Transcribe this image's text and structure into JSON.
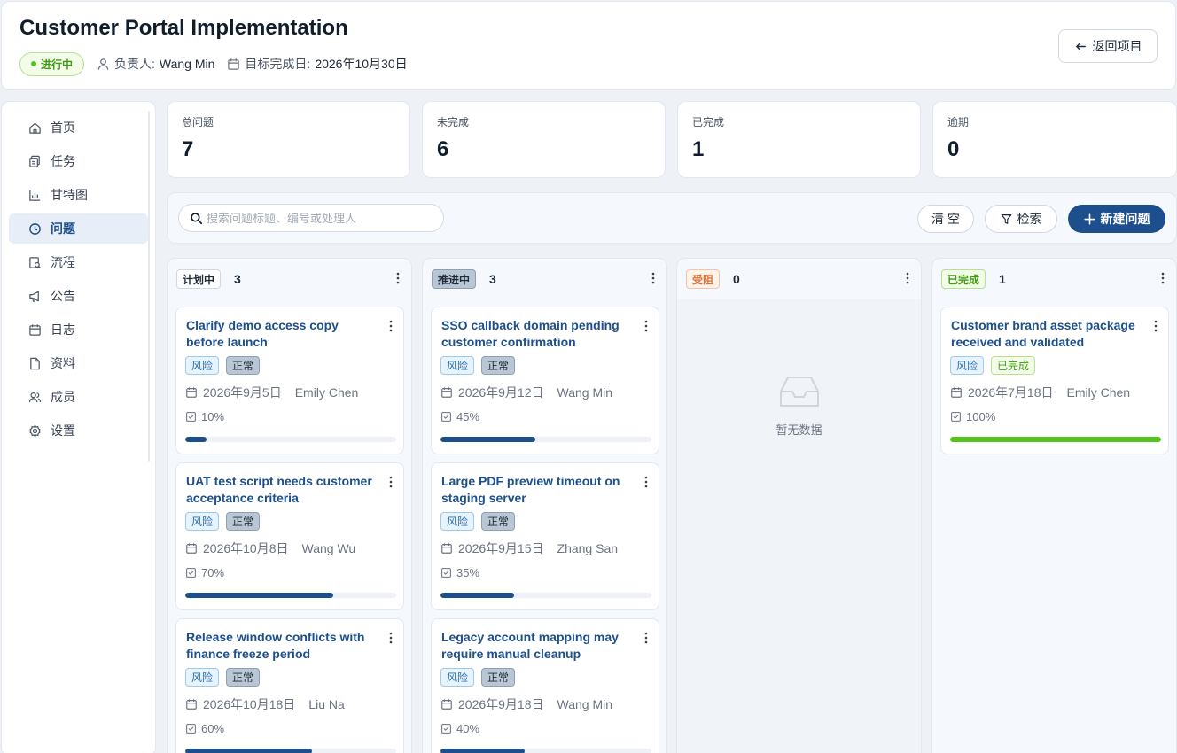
{
  "header": {
    "title": "Customer Portal Implementation",
    "status": "进行中",
    "owner_label": "负责人:",
    "owner": "Wang Min",
    "due_label": "目标完成日:",
    "due": "2026年10月30日",
    "back_label": "返回项目"
  },
  "sidebar": {
    "items": [
      {
        "label": "首页",
        "icon": "home-icon",
        "active": false
      },
      {
        "label": "任务",
        "icon": "tasks-icon",
        "active": false
      },
      {
        "label": "甘特图",
        "icon": "gantt-icon",
        "active": false
      },
      {
        "label": "问题",
        "icon": "issue-icon",
        "active": true
      },
      {
        "label": "流程",
        "icon": "workflow-icon",
        "active": false
      },
      {
        "label": "公告",
        "icon": "megaphone-icon",
        "active": false
      },
      {
        "label": "日志",
        "icon": "calendar-icon",
        "active": false
      },
      {
        "label": "资料",
        "icon": "file-icon",
        "active": false
      },
      {
        "label": "成员",
        "icon": "members-icon",
        "active": false
      },
      {
        "label": "设置",
        "icon": "gear-icon",
        "active": false
      }
    ]
  },
  "stats": [
    {
      "label": "总问题",
      "value": "7"
    },
    {
      "label": "未完成",
      "value": "6"
    },
    {
      "label": "已完成",
      "value": "1"
    },
    {
      "label": "逾期",
      "value": "0"
    }
  ],
  "toolbar": {
    "search_placeholder": "搜索问题标题、编号或处理人",
    "search_value": "",
    "clear_label": "清 空",
    "filter_label": "检索",
    "create_label": "新建问题"
  },
  "columns": [
    {
      "tag": "计划中",
      "count": "3",
      "tag_colors": {
        "bg": "#ffffff",
        "border": "#d0d7e2",
        "text": "#1f2937"
      },
      "cards": [
        {
          "title": "Clarify demo access copy before launch",
          "risk": "风险",
          "state": "正常",
          "date": "2026年9月5日",
          "assignee": "Emily Chen",
          "progress_text": "10%",
          "progress": 0.1
        },
        {
          "title": "UAT test script needs customer acceptance criteria",
          "risk": "风险",
          "state": "正常",
          "date": "2026年10月8日",
          "assignee": "Wang Wu",
          "progress_text": "70%",
          "progress": 0.7
        },
        {
          "title": "Release window conflicts with finance freeze period",
          "risk": "风险",
          "state": "正常",
          "date": "2026年10月18日",
          "assignee": "Liu Na",
          "progress_text": "60%",
          "progress": 0.6
        }
      ]
    },
    {
      "tag": "推进中",
      "count": "3",
      "tag_colors": {
        "bg": "#b9c6d4",
        "border": "#8e9fb2",
        "text": "#1f2937"
      },
      "cards": [
        {
          "title": "SSO callback domain pending customer confirmation",
          "risk": "风险",
          "state": "正常",
          "date": "2026年9月12日",
          "assignee": "Wang Min",
          "progress_text": "45%",
          "progress": 0.45
        },
        {
          "title": "Large PDF preview timeout on staging server",
          "risk": "风险",
          "state": "正常",
          "date": "2026年9月15日",
          "assignee": "Zhang San",
          "progress_text": "35%",
          "progress": 0.35
        },
        {
          "title": "Legacy account mapping may require manual cleanup",
          "risk": "风险",
          "state": "正常",
          "date": "2026年9月18日",
          "assignee": "Wang Min",
          "progress_text": "40%",
          "progress": 0.4
        }
      ]
    },
    {
      "tag": "受阻",
      "count": "0",
      "tag_colors": {
        "bg": "#fff4ec",
        "border": "#f5c3a3",
        "text": "#e0743a"
      },
      "empty_text": "暂无数据",
      "cards": []
    },
    {
      "tag": "已完成",
      "count": "1",
      "tag_colors": {
        "bg": "#f3fbe9",
        "border": "#b7e08f",
        "text": "#3f9a13"
      },
      "cards": [
        {
          "title": "Customer brand asset package received and validated",
          "risk": "风险",
          "state": "已完成",
          "date": "2026年7月18日",
          "assignee": "Emily Chen",
          "progress_text": "100%",
          "progress": 1.0,
          "done": true
        }
      ]
    }
  ],
  "colors": {
    "primary": "#1d4f8c",
    "success": "#52c41a",
    "progress_fill": "#1d4f8c",
    "progress_done": "#52c41a"
  }
}
